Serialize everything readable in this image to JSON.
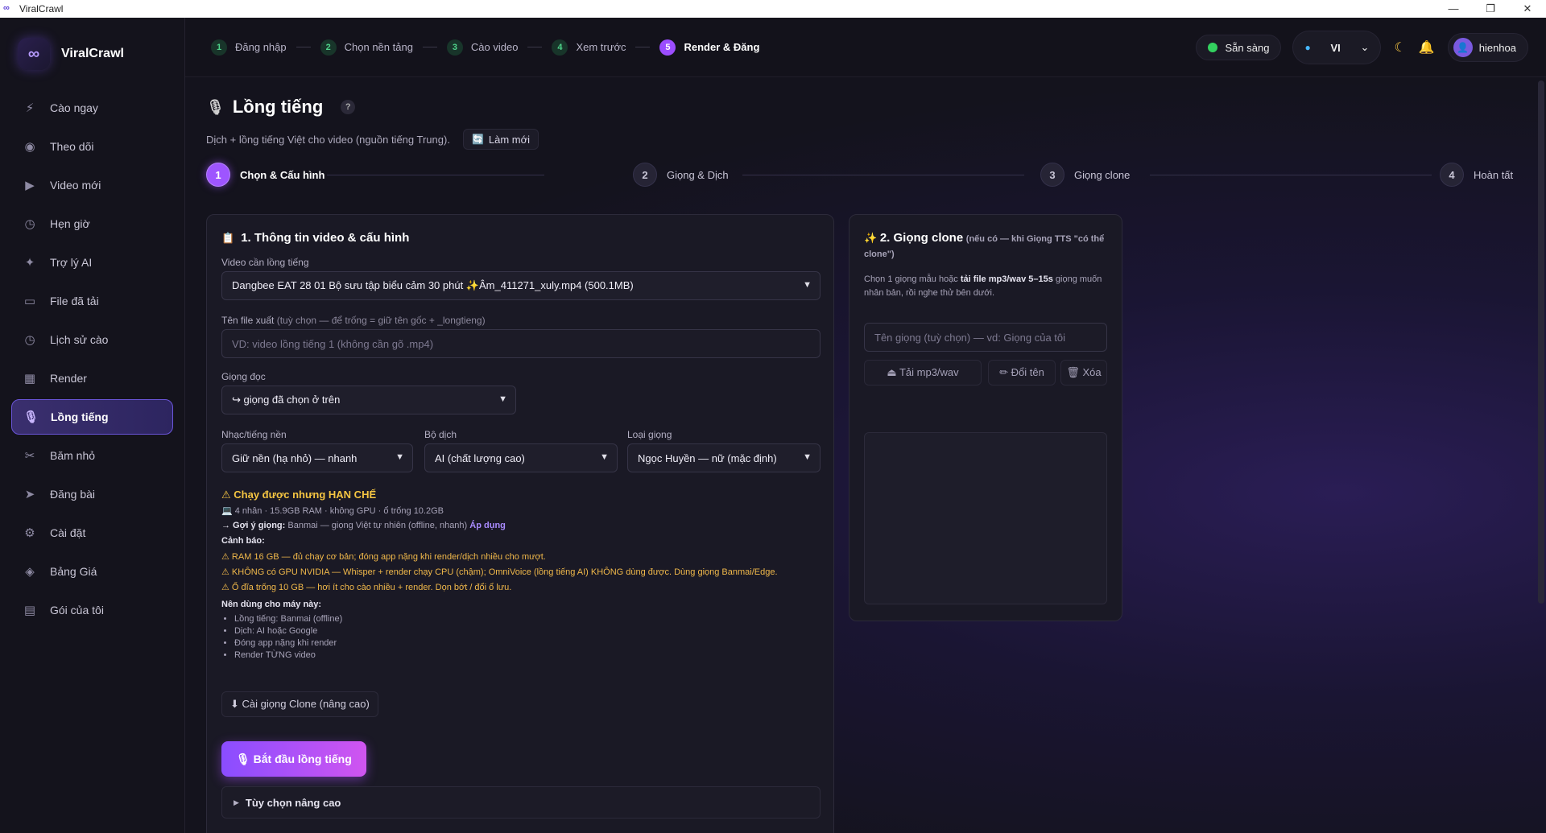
{
  "window": {
    "title": "ViralCrawl",
    "controls": [
      "—",
      "❐",
      "✕"
    ]
  },
  "sidebar": {
    "brand": "ViralCrawl",
    "items": [
      {
        "label": "Cào ngay",
        "icon": "⚡"
      },
      {
        "label": "Theo dõi",
        "icon": "◉"
      },
      {
        "label": "Video mới",
        "icon": "▶"
      },
      {
        "label": "Hẹn giờ",
        "icon": "◷"
      },
      {
        "label": "Trợ lý AI",
        "icon": "✦"
      },
      {
        "label": "File đã tải",
        "icon": "▭"
      },
      {
        "label": "Lịch sử cào",
        "icon": "◷"
      },
      {
        "label": "Render",
        "icon": "▦"
      },
      {
        "label": "Lồng tiếng",
        "icon": "🎙"
      },
      {
        "label": "Băm nhỏ",
        "icon": "✂"
      },
      {
        "label": "Đăng bài",
        "icon": "➤"
      },
      {
        "label": "Cài đặt",
        "icon": "⚙"
      },
      {
        "label": "Bảng Giá",
        "icon": "◈"
      },
      {
        "label": "Gói của tôi",
        "icon": "▤"
      }
    ],
    "active_index": 8
  },
  "topbar": {
    "steps": [
      {
        "num": "1",
        "label": "Đăng nhập"
      },
      {
        "num": "2",
        "label": "Chọn nền tảng"
      },
      {
        "num": "3",
        "label": "Cào video"
      },
      {
        "num": "4",
        "label": "Xem trước"
      },
      {
        "num": "5",
        "label": "Render & Đăng"
      }
    ],
    "status": "Sẵn sàng",
    "language": "VI",
    "username": "hienhoa"
  },
  "page": {
    "title": "Lồng tiếng",
    "help": "?",
    "subtitle": "Dịch + lồng tiếng Việt cho video (nguồn tiếng Trung).",
    "refresh_label": "Làm mới"
  },
  "wizard": [
    {
      "num": "1",
      "label": "Chọn & Cấu hình"
    },
    {
      "num": "2",
      "label": "Giọng & Dịch"
    },
    {
      "num": "3",
      "label": "Giọng clone"
    },
    {
      "num": "4",
      "label": "Hoàn tất"
    }
  ],
  "config": {
    "title": "1. Thông tin video & cấu hình",
    "video_label": "Video cần lồng tiếng",
    "video_value": "Dangbee EAT 28 01 Bộ sưu tập biểu cảm 30 phút ✨Âm_411271_xuly.mp4 (500.1MB)",
    "filename_label": "Tên file xuất",
    "filename_hint": "(tuỳ chọn — để trống = giữ tên gốc + _longtieng)",
    "filename_placeholder": "VD: video lồng tiếng 1 (không cần gõ .mp4)",
    "voice_label": "Giọng đọc",
    "voice_value": "↪ giọng đã chọn ở trên",
    "music_label": "Nhạc/tiếng nền",
    "music_value": "Giữ nền (hạ nhỏ) — nhanh",
    "translator_label": "Bộ dịch",
    "translator_value": "AI (chất lượng cao)",
    "voice_type_label": "Loại giọng",
    "voice_type_value": "Ngọc Huyền — nữ (mặc định)",
    "warning_title": "Chạy được nhưng HẠN CHẾ",
    "system_info": "💻 4 nhân · 15.9GB RAM · không GPU · ổ trống 10.2GB",
    "suggest_prefix": "→ Gợi ý giọng:",
    "suggest_text": "Banmai — giọng Việt tự nhiên (offline, nhanh)",
    "suggest_apply": "Áp dụng",
    "warnings_label": "Cảnh báo:",
    "warnings": [
      "⚠ RAM 16 GB — đủ chạy cơ bản; đóng app nặng khi render/dịch nhiều cho mượt.",
      "⚠ KHÔNG có GPU NVIDIA — Whisper + render chạy CPU (chậm); OmniVoice (lồng tiếng AI) KHÔNG dùng được. Dùng giọng Banmai/Edge.",
      "⚠ Ổ đĩa trống 10 GB — hơi ít cho cào nhiều + render. Dọn bớt / đổi ổ lưu."
    ],
    "recommend_label": "Nên dùng cho máy này:",
    "recommendations": [
      "Lồng tiếng: Banmai (offline)",
      "Dịch: AI hoặc Google",
      "Đóng app nặng khi render",
      "Render TỪNG video"
    ],
    "install_clone_label": "⬇ Cài giọng Clone (nâng cao)",
    "start_label": "🎙 Bắt đầu lồng tiếng",
    "advanced_label": "Tùy chọn nâng cao"
  },
  "clone": {
    "title": "2. Giọng clone",
    "title_note": "(nếu có — khi Giọng TTS \"có thể clone\")",
    "desc_prefix": "Chọn 1 giọng mẫu hoặc",
    "desc_bold": "tải file mp3/wav 5–15s",
    "desc_suffix": "giọng muốn nhân bản, rồi nghe thử bên dưới.",
    "name_placeholder": "Tên giọng (tuỳ chọn) — vd: Giọng của tôi",
    "upload_label": "⏏ Tải mp3/wav",
    "rename_label": "✏ Đổi tên",
    "delete_label": "🗑 Xóa"
  }
}
